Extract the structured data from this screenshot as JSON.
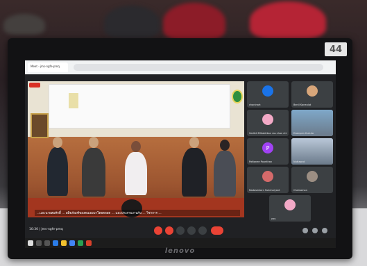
{
  "monitor": {
    "badge": "44",
    "brand": "lenovo"
  },
  "browser": {
    "tab_title": "Meet - jms-ngfe-pmq"
  },
  "meet": {
    "caption": "...และนายสมศักดิ์ ... ผลิตภัณฑ์ของตนเองมาโดยตลอด ... และประสานงานกับ ... วิชาการ ...",
    "meeting_code": "10:30 | jms-ngfe-pmq",
    "participants": [
      {
        "name": "chaninart",
        "color": "#3c4043",
        "kind": "avatar",
        "initial": "",
        "avatar_color": "#1a73e8"
      },
      {
        "name": "Benll Kanealat",
        "color": "#3c4043",
        "kind": "avatar",
        "initial": "",
        "avatar_color": "#d8a67a"
      },
      {
        "name": "Sedikit Rittakitkan ras chon chiu",
        "color": "#3c4043",
        "kind": "avatar",
        "initial": "",
        "avatar_color": "#f2a9c6"
      },
      {
        "name": "Duenpen thai-ko",
        "color": "#7fa8c9",
        "kind": "video",
        "initial": "",
        "avatar_color": ""
      },
      {
        "name": "Pattanee Poonthan",
        "color": "#3c4043",
        "kind": "avatar",
        "initial": "P",
        "avatar_color": "#a142f4"
      },
      {
        "name": "Nuttawut",
        "color": "#b9c7d8",
        "kind": "video",
        "initial": "",
        "avatar_color": ""
      },
      {
        "name": "Nadasinkorn Sukchaiyant",
        "color": "#3c4043",
        "kind": "avatar",
        "initial": "",
        "avatar_color": "#d46a6a"
      },
      {
        "name": "Chainamon",
        "color": "#3c4043",
        "kind": "avatar",
        "initial": "",
        "avatar_color": "#9c8e83"
      },
      {
        "name": "you",
        "color": "#3c4043",
        "kind": "avatar",
        "initial": "",
        "avatar_color": "#f2a9c6"
      }
    ]
  }
}
